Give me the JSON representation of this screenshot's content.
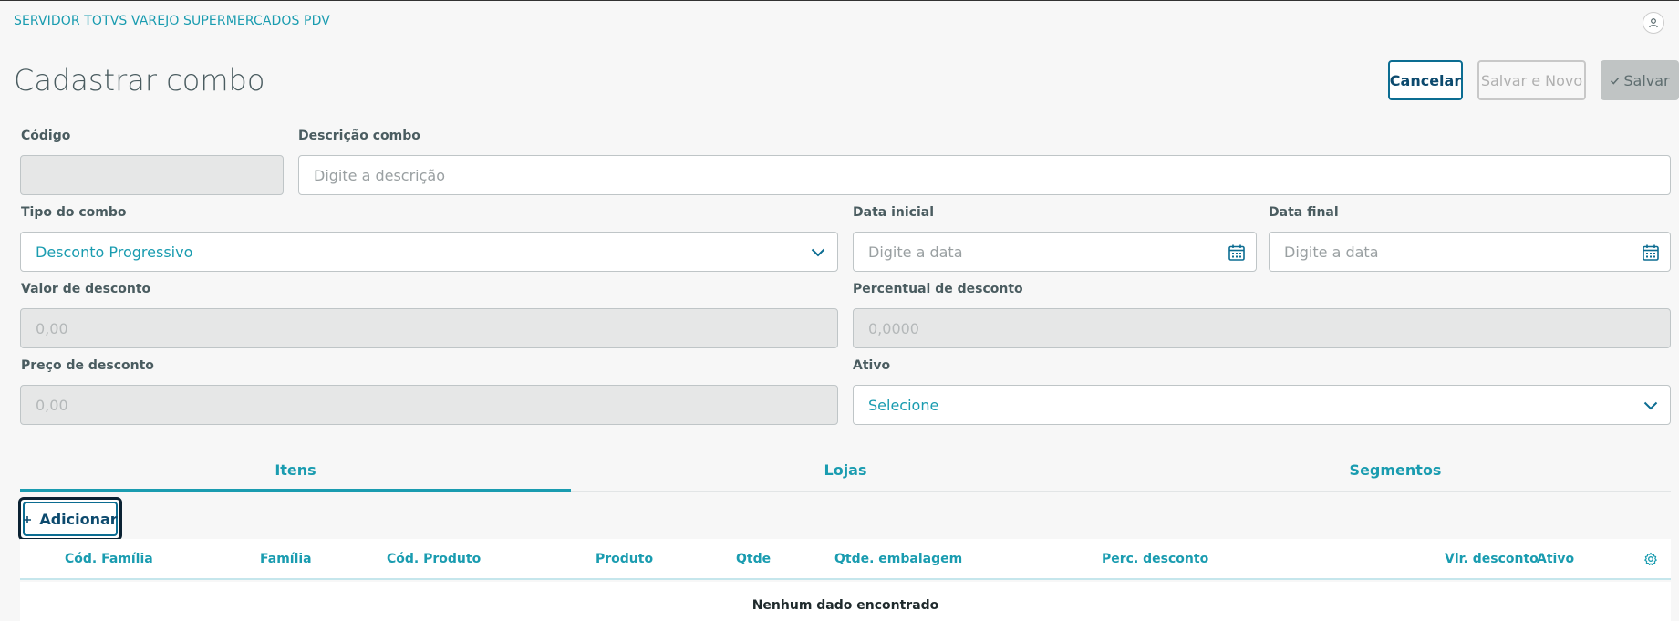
{
  "header": {
    "app_title": "SERVIDOR TOTVS VAREJO SUPERMERCADOS PDV",
    "user_icon": "user-icon"
  },
  "page": {
    "title": "Cadastrar combo"
  },
  "actions": {
    "cancel": "Cancelar",
    "save_new": "Salvar e Novo",
    "save": "Salvar"
  },
  "form": {
    "codigo": {
      "label": "Código",
      "value": ""
    },
    "descricao": {
      "label": "Descrição combo",
      "placeholder": "Digite a descrição"
    },
    "tipo": {
      "label": "Tipo do combo",
      "value": "Desconto Progressivo"
    },
    "data_inicial": {
      "label": "Data inicial",
      "placeholder": "Digite a data"
    },
    "data_final": {
      "label": "Data final",
      "placeholder": "Digite a data"
    },
    "valor_desconto": {
      "label": "Valor de desconto",
      "placeholder": "0,00"
    },
    "percentual_desconto": {
      "label": "Percentual de desconto",
      "placeholder": "0,0000"
    },
    "preco_desconto": {
      "label": "Preço de desconto",
      "placeholder": "0,00"
    },
    "ativo": {
      "label": "Ativo",
      "value": "Selecione"
    }
  },
  "tabs": [
    {
      "label": "Itens",
      "active": true
    },
    {
      "label": "Lojas",
      "active": false
    },
    {
      "label": "Segmentos",
      "active": false
    }
  ],
  "items": {
    "add_label": "Adicionar",
    "columns": [
      "Cód. Família",
      "Família",
      "Cód. Produto",
      "Produto",
      "Qtde",
      "Qtde. embalagem",
      "Perc. desconto",
      "Vlr. desconto",
      "Ativo"
    ],
    "empty_text": "Nenhum dado encontrado"
  },
  "colors": {
    "accent": "#1a9cb0",
    "primary": "#0c6d92"
  }
}
